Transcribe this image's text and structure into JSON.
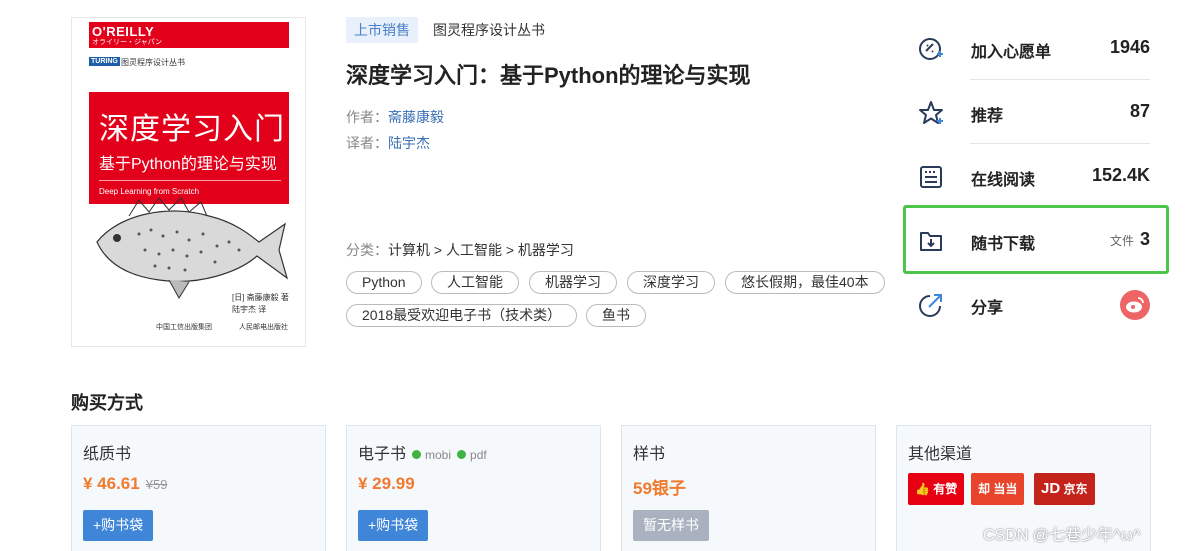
{
  "cover": {
    "brand": "O'REILLY",
    "brand_sub": "オライリー・ジャパン",
    "series_logo": "TURING",
    "series_text": "图灵程序设计丛书",
    "title_big": "深度学习入门",
    "title_sub": "基于Python的理论与实现",
    "title_en": "Deep Learning from Scratch",
    "author_line1": "[日] 斋藤康毅 著",
    "author_line2": "陆宇杰 译",
    "publisher1": "中国工信出版集团",
    "publisher2": "人民邮电出版社"
  },
  "book": {
    "status_tag": "上市销售",
    "series": "图灵程序设计丛书",
    "title": "深度学习入门：基于Python的理论与实现",
    "author_label": "作者：",
    "author": "斋藤康毅",
    "translator_label": "译者：",
    "translator": "陆宇杰",
    "category_label": "分类：",
    "category_path": "计算机 > 人工智能 > 机器学习",
    "tags": [
      "Python",
      "人工智能",
      "机器学习",
      "深度学习",
      "悠长假期，最佳40本",
      "2018最受欢迎电子书（技术类）",
      "鱼书"
    ]
  },
  "panel": {
    "wishlist": {
      "label": "加入心愿单",
      "value": "1946",
      "icon": "wishlist-icon"
    },
    "recommend": {
      "label": "推荐",
      "value": "87",
      "icon": "star-icon"
    },
    "read": {
      "label": "在线阅读",
      "value": "152.4K",
      "icon": "reader-icon"
    },
    "download": {
      "label": "随书下载",
      "file_label": "文件",
      "value": "3",
      "icon": "download-folder-icon"
    },
    "share": {
      "label": "分享",
      "icon": "share-icon"
    },
    "highlight_color": "#4cc54a"
  },
  "purchase": {
    "title": "购买方式",
    "paper": {
      "title": "纸质书",
      "price": "¥ 46.61",
      "old_price": "¥59",
      "button": "+购书袋"
    },
    "ebook": {
      "title": "电子书",
      "format1": "mobi",
      "format2": "pdf",
      "price": "¥ 29.99",
      "button": "+购书袋"
    },
    "sample": {
      "title": "样书",
      "price": "59银子",
      "button": "暂无样书"
    },
    "other": {
      "title": "其他渠道",
      "channels": [
        "有赞",
        "当当",
        "京东"
      ]
    }
  },
  "colors": {
    "accent": "#3f86d9",
    "price": "#f07a2e",
    "cover_red": "#e2001a"
  },
  "watermark": "CSDN @七巷少年^ω^"
}
